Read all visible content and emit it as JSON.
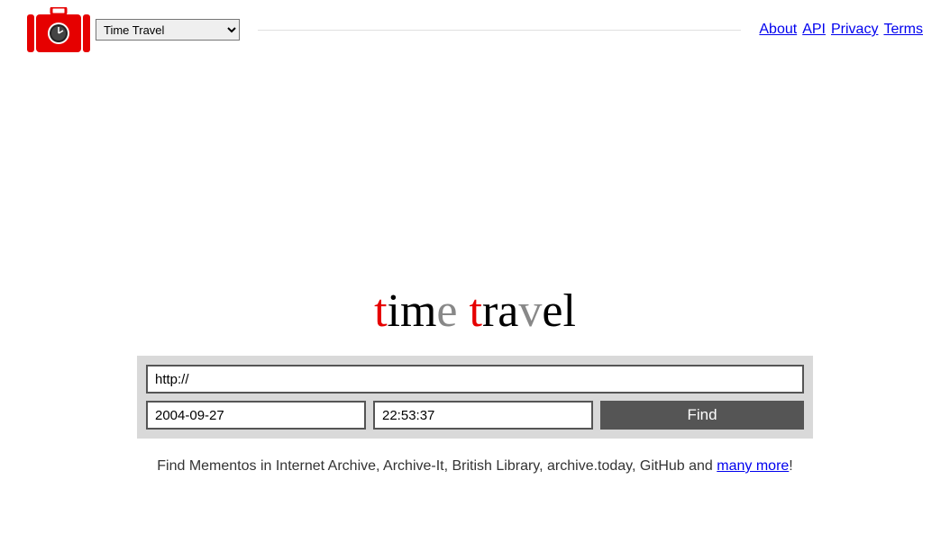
{
  "header": {
    "nav_select_value": "Time Travel",
    "links": {
      "about": "About",
      "api": "API",
      "privacy": "Privacy",
      "terms": "Terms"
    }
  },
  "title": {
    "t1": "t",
    "im": "im",
    "e1": "e",
    "space": " ",
    "t2": "t",
    "ra": "ra",
    "v": "v",
    "e2": "e",
    "l": "l"
  },
  "search": {
    "url_value": "http://",
    "date_value": "2004-09-27",
    "time_value": "22:53:37",
    "find_label": "Find"
  },
  "tagline": {
    "text": "Find Mementos in Internet Archive, Archive-It, British Library, archive.today, GitHub and ",
    "link": "many more",
    "exclaim": "!"
  }
}
